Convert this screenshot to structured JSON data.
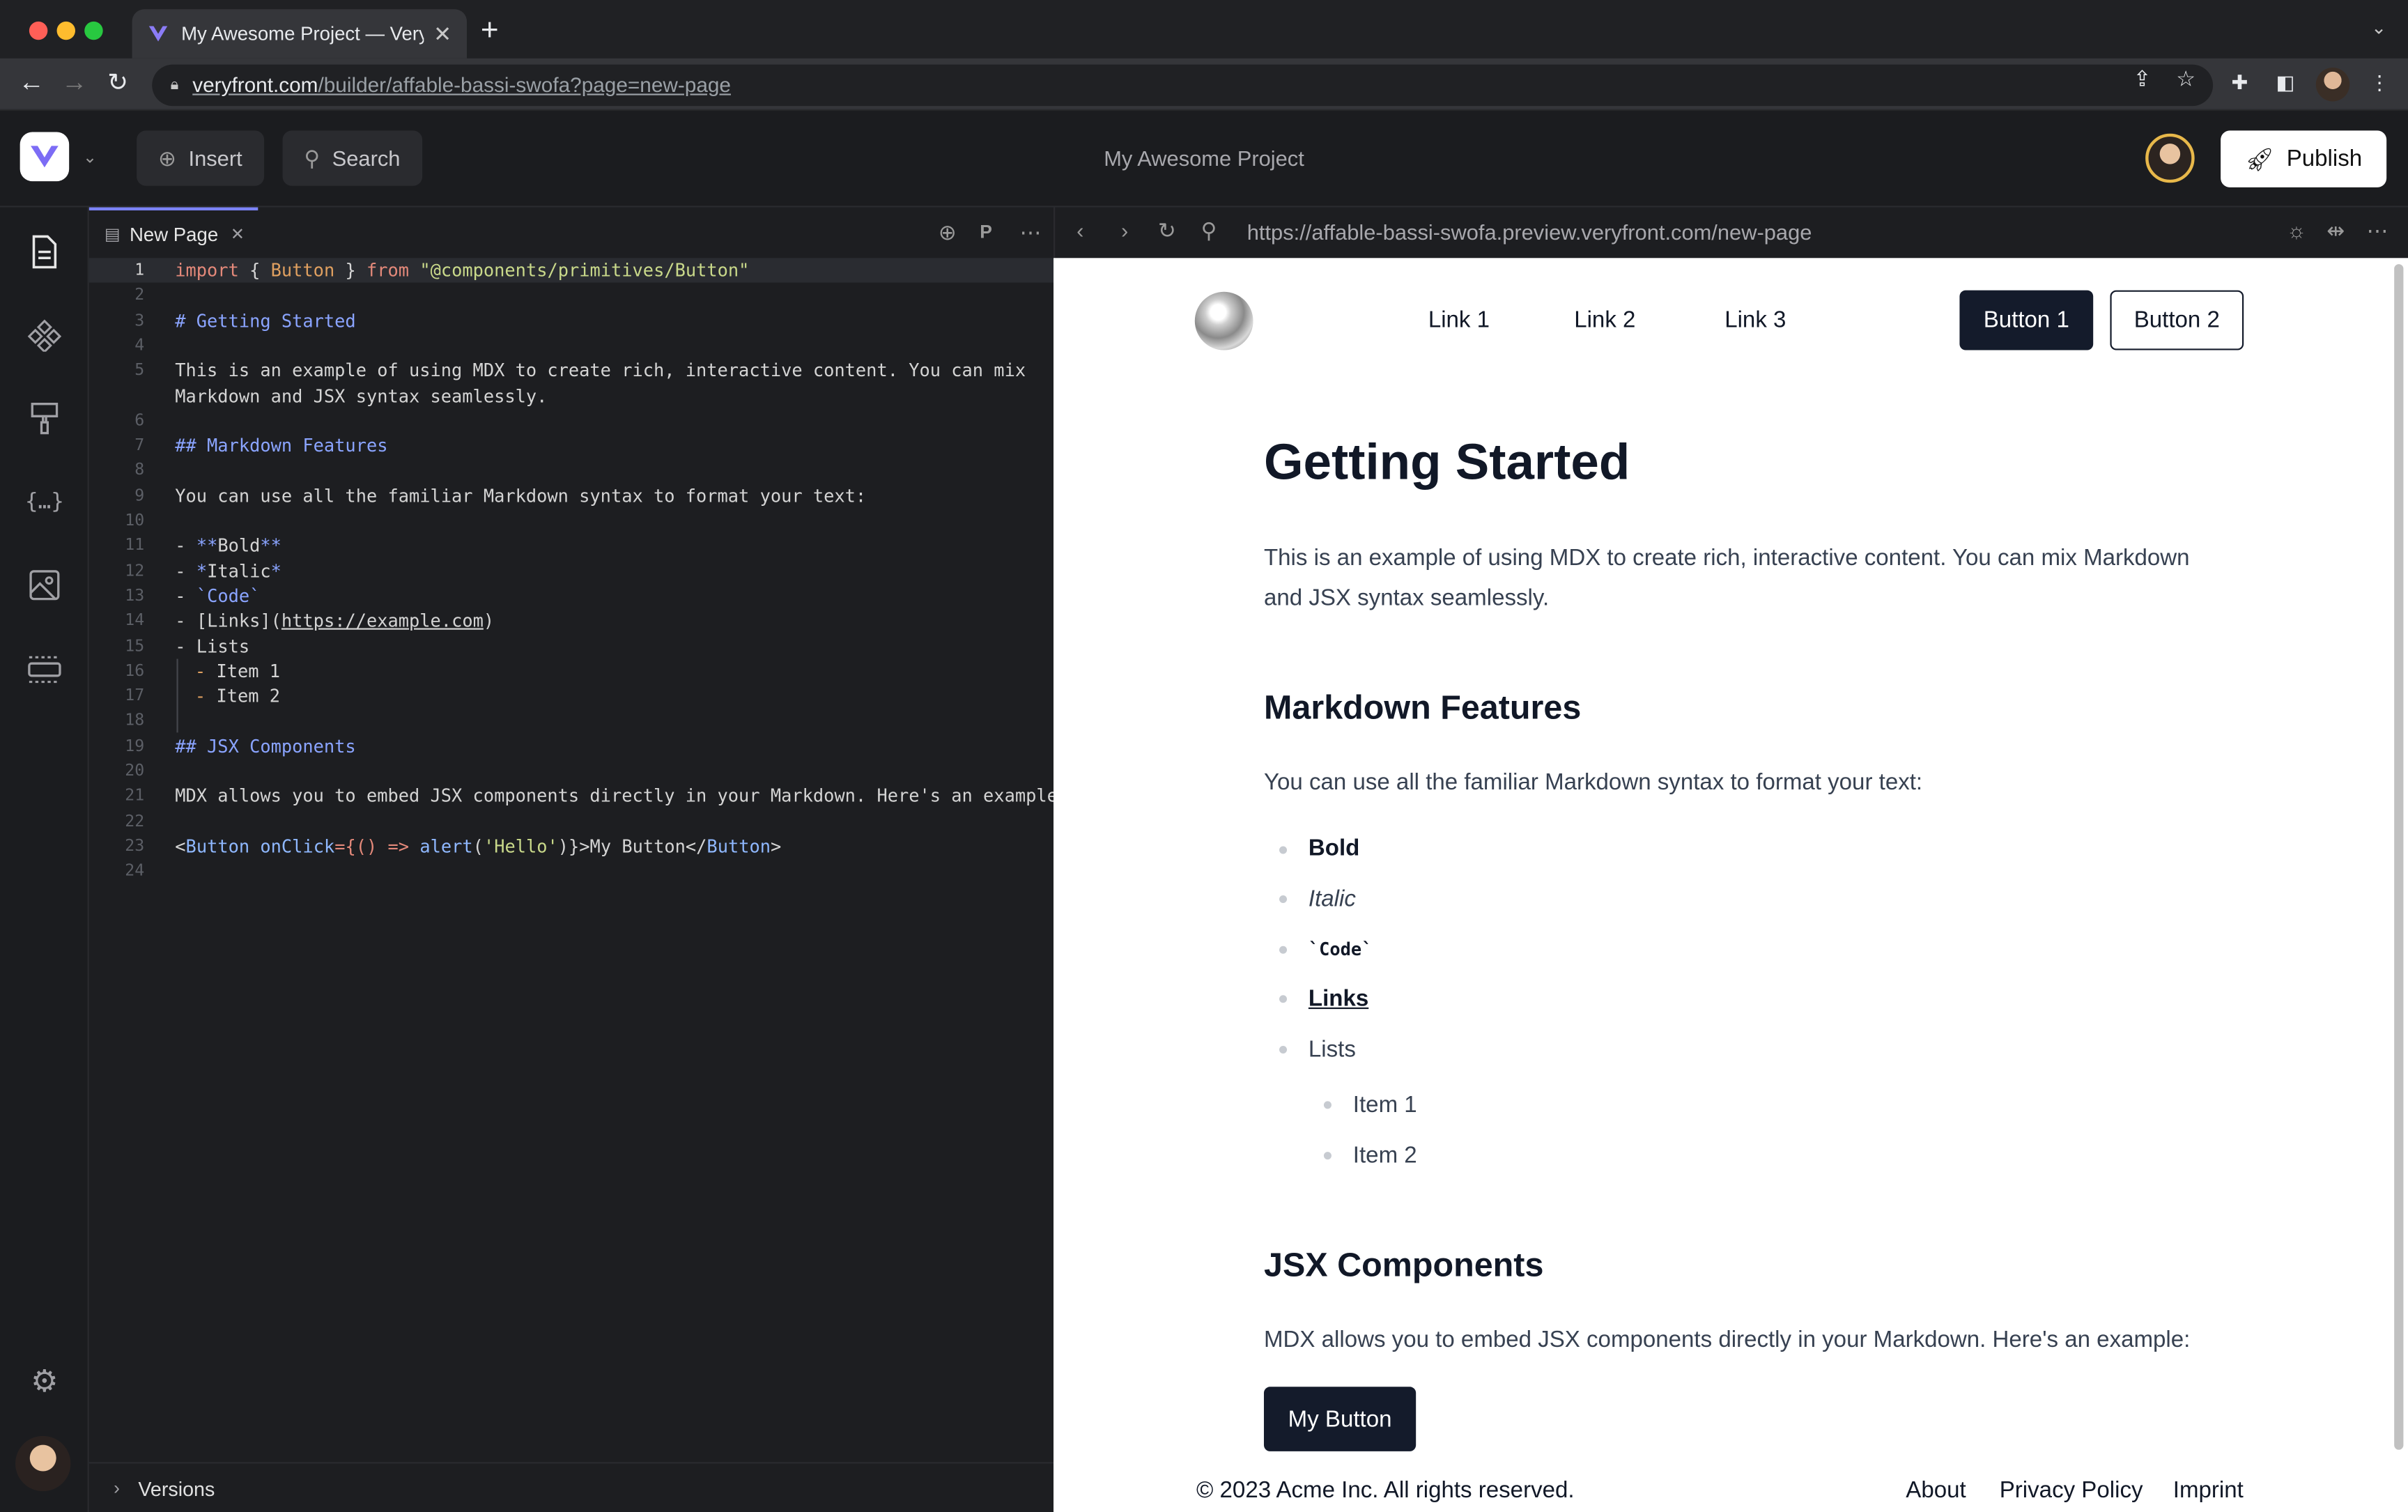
{
  "browser": {
    "tab_title": "My Awesome Project — Veryfront",
    "url_host": "veryfront.com",
    "url_path": "/builder/affable-bassi-swofa?page=new-page"
  },
  "header": {
    "insert_label": "Insert",
    "search_label": "Search",
    "project_name": "My Awesome Project",
    "publish_label": "Publish"
  },
  "sidebar": {
    "items": [
      "pages-icon",
      "components-icon",
      "styles-icon",
      "data-icon",
      "assets-icon",
      "layouts-icon",
      "settings-icon"
    ]
  },
  "editor": {
    "tab_label": "New Page",
    "line_numbers": [
      "1",
      "2",
      "3",
      "4",
      "5",
      "6",
      "7",
      "8",
      "9",
      "10",
      "11",
      "12",
      "13",
      "14",
      "15",
      "16",
      "17",
      "18",
      "19",
      "20",
      "21",
      "22",
      "23",
      "24"
    ],
    "code": {
      "l1_import": "import",
      "l1_brace_open": " { ",
      "l1_component": "Button",
      "l1_brace_close": " } ",
      "l1_from": "from",
      "l1_path": " \"@components/primitives/Button\"",
      "l3": "# Getting Started",
      "l5a": "This is an example of using MDX to create rich, interactive content. You can mix",
      "l5b": "Markdown and JSX syntax seamlessly.",
      "l7": "## Markdown Features",
      "l9": "You can use all the familiar Markdown syntax to format your text:",
      "l11_bullet": "- ",
      "l11_mark": "**",
      "l11_text": "Bold",
      "l12_bullet": "- ",
      "l12_mark": "*",
      "l12_text": "Italic",
      "l13_bullet": "- ",
      "l13_mark": "`",
      "l13_text": "Code",
      "l14_bullet": "- ",
      "l14_text": "[Links](",
      "l14_url": "https://example.com",
      "l14_close": ")",
      "l15_bullet": "- ",
      "l15_text": "Lists",
      "l16_bullet": "- ",
      "l16_text": "Item 1",
      "l17_bullet": "- ",
      "l17_text": "Item 2",
      "l19": "## JSX Components",
      "l21": "MDX allows you to embed JSX components directly in your Markdown. Here's an example:",
      "l23_open": "<",
      "l23_comp": "Button",
      "l23_attr": " onClick",
      "l23_eq": "={() ",
      "l23_arrow": "=>",
      "l23_fn": " alert",
      "l23_paren": "(",
      "l23_str": "'Hello'",
      "l23_rest": ")}>My Button</",
      "l23_comp2": "Button",
      "l23_end": ">"
    },
    "versions_label": "Versions"
  },
  "preview": {
    "url": "https://affable-bassi-swofa.preview.veryfront.com/new-page",
    "nav_links": [
      "Link 1",
      "Link 2",
      "Link 3"
    ],
    "button1": "Button 1",
    "button2": "Button 2",
    "title": "Getting Started",
    "intro": "This is an example of using MDX to create rich, interactive content. You can mix Markdown and JSX syntax seamlessly.",
    "section1_title": "Markdown Features",
    "section1_text": "You can use all the familiar Markdown syntax to format your text:",
    "list": {
      "bold": "Bold",
      "italic": "Italic",
      "code": "`Code`",
      "links": "Links",
      "lists": "Lists",
      "item1": "Item 1",
      "item2": "Item 2"
    },
    "section2_title": "JSX Components",
    "section2_text": "MDX allows you to embed JSX components directly in your Markdown. Here's an example:",
    "my_button": "My Button",
    "footer": {
      "copyright": "© 2023 Acme Inc. All rights reserved.",
      "links": [
        "About",
        "Privacy Policy",
        "Imprint"
      ]
    }
  },
  "colors": {
    "accent": "#7c83f7",
    "dark_button": "#141b2b",
    "editor_bg": "#1d1e21"
  }
}
